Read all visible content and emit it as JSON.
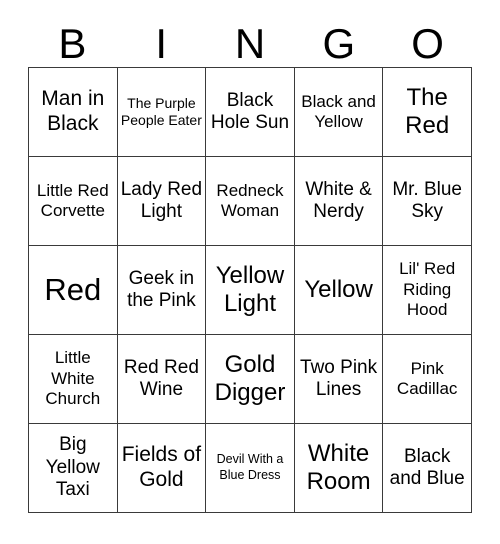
{
  "card": {
    "header_letters": [
      "B",
      "I",
      "N",
      "G",
      "O"
    ],
    "rows": [
      [
        {
          "text": "Man in Black",
          "size": "lg"
        },
        {
          "text": "The Purple People Eater",
          "size": "xs"
        },
        {
          "text": "Black Hole Sun",
          "size": "md"
        },
        {
          "text": "Black and Yellow",
          "size": "sm"
        },
        {
          "text": "The Red",
          "size": "xl"
        }
      ],
      [
        {
          "text": "Little Red Corvette",
          "size": "sm"
        },
        {
          "text": "Lady Red Light",
          "size": "md"
        },
        {
          "text": "Redneck Woman",
          "size": "sm"
        },
        {
          "text": "White & Nerdy",
          "size": "md"
        },
        {
          "text": "Mr. Blue Sky",
          "size": "md"
        }
      ],
      [
        {
          "text": "Red",
          "size": "xxl"
        },
        {
          "text": "Geek in the Pink",
          "size": "md"
        },
        {
          "text": "Yellow Light",
          "size": "xl"
        },
        {
          "text": "Yellow",
          "size": "xl"
        },
        {
          "text": "Lil' Red Riding Hood",
          "size": "sm"
        }
      ],
      [
        {
          "text": "Little White Church",
          "size": "sm"
        },
        {
          "text": "Red Red Wine",
          "size": "md"
        },
        {
          "text": "Gold Digger",
          "size": "xl"
        },
        {
          "text": "Two Pink Lines",
          "size": "md"
        },
        {
          "text": "Pink Cadillac",
          "size": "sm"
        }
      ],
      [
        {
          "text": "Big Yellow Taxi",
          "size": "md"
        },
        {
          "text": "Fields of Gold",
          "size": "lg"
        },
        {
          "text": "Devil With a Blue Dress",
          "size": "xxs"
        },
        {
          "text": "White Room",
          "size": "xl"
        },
        {
          "text": "Black and Blue",
          "size": "md"
        }
      ]
    ]
  }
}
